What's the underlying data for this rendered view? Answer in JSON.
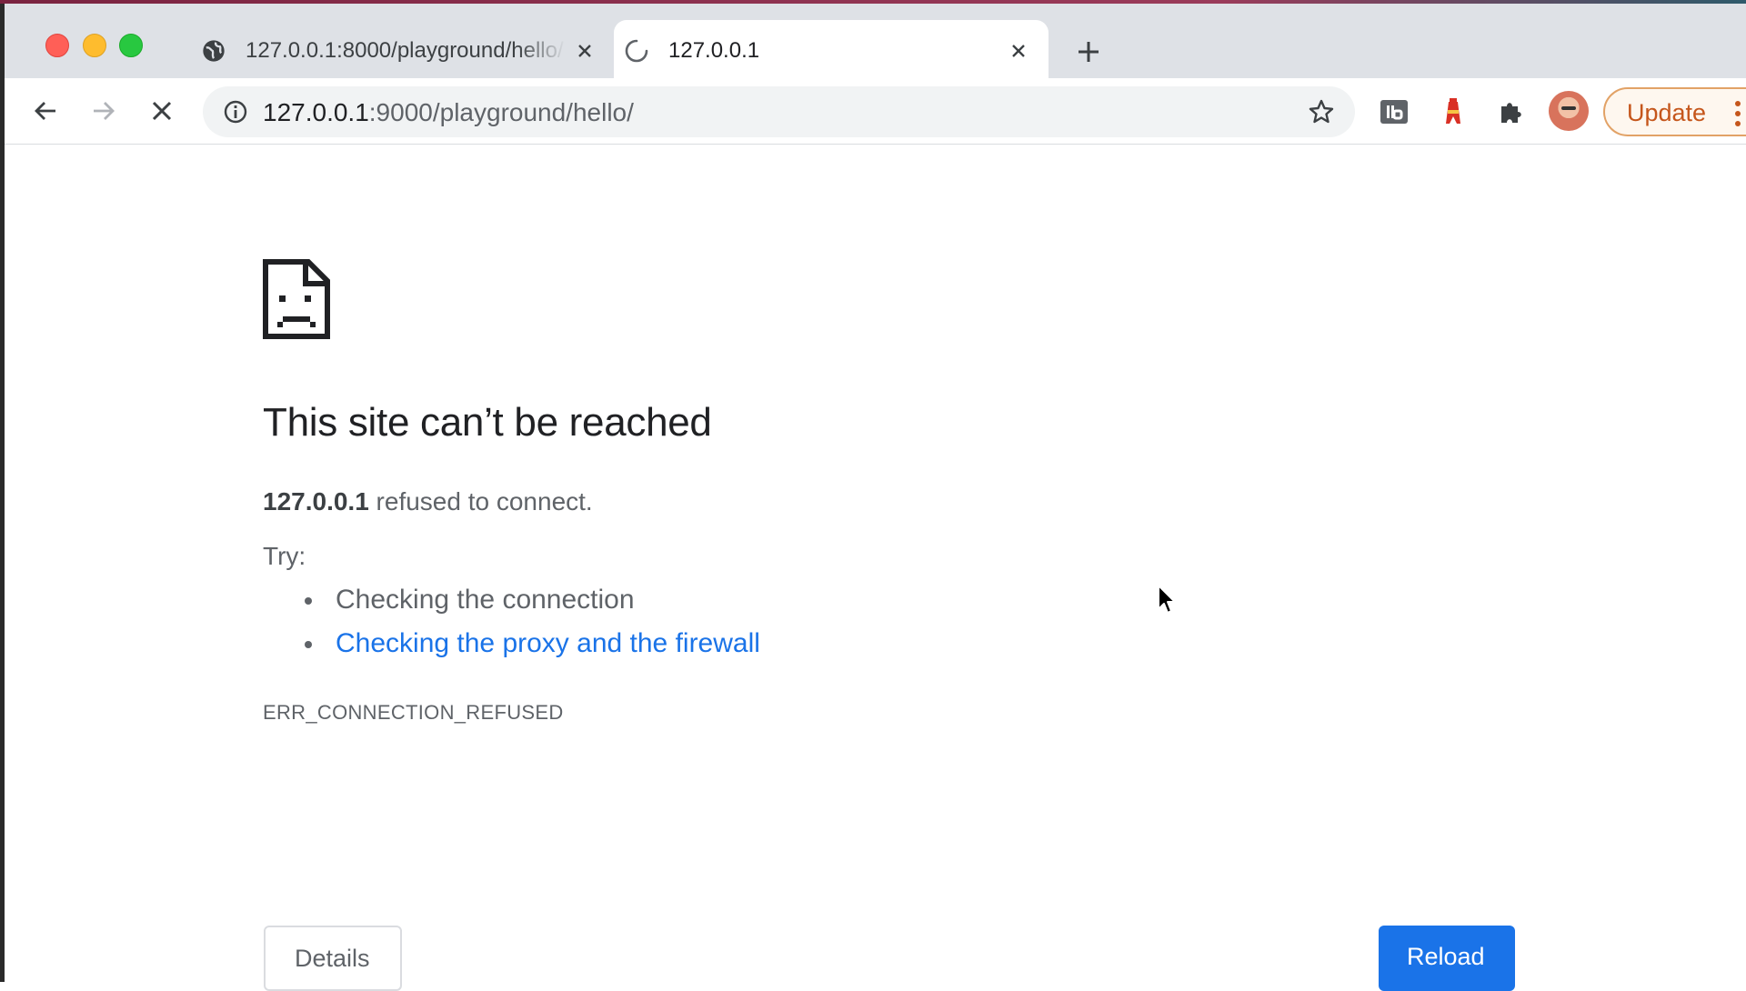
{
  "browser": {
    "tabs": [
      {
        "title": "127.0.0.1:8000/playground/hello/",
        "active": false,
        "favicon": "globe-icon"
      },
      {
        "title": "127.0.0.1",
        "active": true,
        "favicon": "loading-spinner-icon"
      }
    ],
    "address_bar": {
      "host": "127.0.0.1",
      "rest": ":9000/playground/hello/"
    },
    "toolbar": {
      "update_label": "Update"
    },
    "colors": {
      "accent": "#1a73e8",
      "update_text": "#c5561b"
    }
  },
  "error_page": {
    "title": "This site can’t be reached",
    "host": "127.0.0.1",
    "message": " refused to connect.",
    "try_label": "Try:",
    "suggestions": [
      {
        "text": "Checking the connection",
        "is_link": false
      },
      {
        "text": "Checking the proxy and the firewall",
        "is_link": true
      }
    ],
    "error_code": "ERR_CONNECTION_REFUSED",
    "details_label": "Details",
    "reload_label": "Reload"
  }
}
